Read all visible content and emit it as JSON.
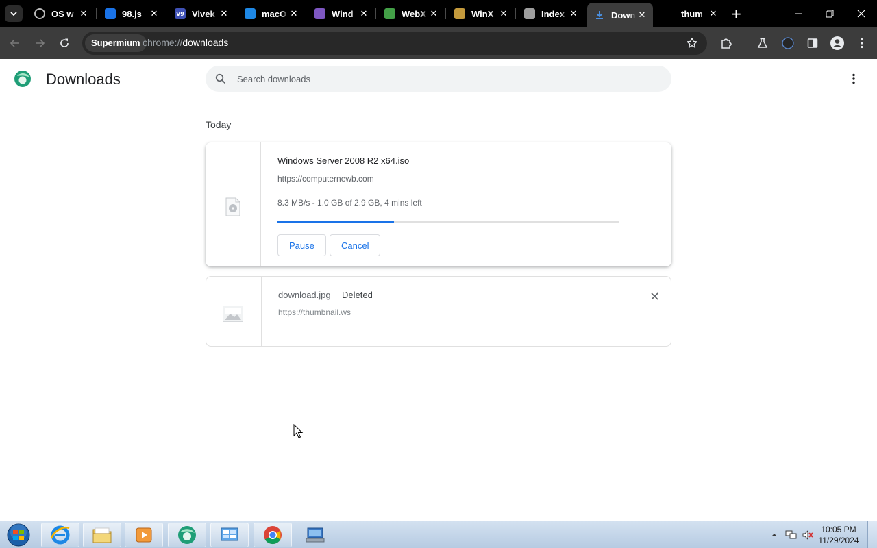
{
  "browser": {
    "tabs": [
      {
        "title": "OS w",
        "favicon": "os-icon",
        "color": "#5f6368"
      },
      {
        "title": "98.js",
        "favicon": "98js-icon",
        "color": "#1a73e8"
      },
      {
        "title": "Vivek",
        "favicon": "v9-icon",
        "color": "#3f51b5"
      },
      {
        "title": "macO",
        "favicon": "macos-icon",
        "color": "#1e88e5"
      },
      {
        "title": "Wind",
        "favicon": "windows-icon",
        "color": "#7e57c2"
      },
      {
        "title": "WebX",
        "favicon": "webx-icon",
        "color": "#43a047"
      },
      {
        "title": "WinX",
        "favicon": "winxp-icon",
        "color": "#c49a3c"
      },
      {
        "title": "Index",
        "favicon": "index-icon",
        "color": "#9e9e9e"
      },
      {
        "title": "Down",
        "favicon": "download-icon",
        "color": "#1a73e8",
        "active": true
      },
      {
        "title": "thum",
        "favicon": "",
        "color": "#000000"
      }
    ],
    "omnibox": {
      "chip": "Supermium",
      "scheme": "chrome://",
      "host": "downloads"
    }
  },
  "page": {
    "title": "Downloads",
    "search_placeholder": "Search downloads",
    "section": "Today",
    "downloads": [
      {
        "name": "Windows Server 2008 R2 x64.iso",
        "source": "https://computernewb.com",
        "status": "8.3 MB/s - 1.0 GB of 2.9 GB, 4 mins left",
        "progress": 0.34,
        "buttons": [
          "Pause",
          "Cancel"
        ]
      },
      {
        "name": "download.jpg",
        "tag": "Deleted",
        "source": "https://thumbnail.ws"
      }
    ]
  },
  "taskbar": {
    "clock_time": "10:05 PM",
    "clock_date": "11/29/2024"
  }
}
